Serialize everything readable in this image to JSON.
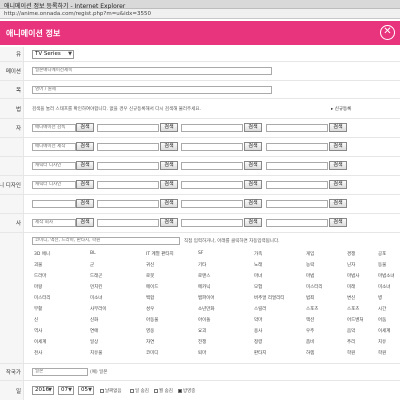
{
  "browser": {
    "title": "애니메이션 정보 등록하기 - Internet Explorer",
    "url": "http://anime.onnada.com/regist.php?m=u&idx=3550"
  },
  "header": {
    "title": "애니메이션 정보",
    "close_glyph": "✕"
  },
  "labels": {
    "type": "유",
    "title_row": "메이션",
    "orig_row": "목",
    "notice_row": "법",
    "r1": "자",
    "r2": "",
    "r3": "",
    "r4": "애니 디자인",
    "r5": "",
    "r6": "사",
    "country": "작국가",
    "date": "일"
  },
  "type_select": "TV Series",
  "title_value": "일본애니메이션제목",
  "orig_value": "영어 / 원제",
  "notice_text": "검색을 눌러 스태프를 확인하여야합니다. 없을 경우 신규등록해서 다시 검색해 불러주세요.",
  "notice_link": "▸ 신규등록",
  "search_label": "검색",
  "staff_rows": [
    [
      "애니메이션 감독",
      "",
      "",
      ""
    ],
    [
      "애니메이션 제작",
      "",
      "",
      ""
    ],
    [
      "캐릭터 디자인",
      "",
      "",
      ""
    ],
    [
      "캐릭터 디자인",
      "",
      "",
      ""
    ],
    [
      "",
      "",
      "",
      ""
    ],
    [
      "제작 회사",
      "",
      "",
      ""
    ]
  ],
  "genre_hint": "직접 입력하거나, 아래를 클릭하면 자동입력됩니다.",
  "genre_input": "코미디, 액션, 드라마, 판타지, 학원",
  "genres": [
    [
      "3D 애니",
      "BL",
      "IT 계열 판타지",
      "SF",
      "가족",
      "게임",
      "경쟁",
      "공포"
    ],
    [
      "괴물",
      "군",
      "귀신",
      "기타",
      "노래",
      "농락",
      "닌자",
      "동물"
    ],
    [
      "드라마",
      "드래곤",
      "로봇",
      "로맨스",
      "마녀",
      "마법",
      "마법사",
      "마법소녀"
    ],
    [
      "마왕",
      "먼치킨",
      "메이드",
      "메카닉",
      "모험",
      "미스터리",
      "미래",
      "미소녀"
    ],
    [
      "미스터리",
      "미소녀",
      "백합",
      "뱀파이어",
      "버추얼 리얼리티",
      "범죄",
      "변신",
      "병"
    ],
    [
      "부활",
      "사무라이",
      "성우",
      "소년만화",
      "스릴러",
      "스포츠",
      "스포츠",
      "시간"
    ],
    [
      "신",
      "신화",
      "아동물",
      "아이돌",
      "악마",
      "액션",
      "어드벤처",
      "어둠"
    ],
    [
      "역사",
      "연애",
      "영웅",
      "요괴",
      "용사",
      "우주",
      "음악",
      "이세계"
    ],
    [
      "이세계",
      "일상",
      "자연",
      "전쟁",
      "정령",
      "좀비",
      "추리",
      "치유"
    ],
    [
      "천사",
      "치유물",
      "코미디",
      "퇴마",
      "판타지",
      "하렘",
      "학원",
      "학원"
    ]
  ],
  "country_value": "일본",
  "country_suffix": "(예) 일본",
  "date": {
    "year": "2016",
    "month": "07",
    "day": "05"
  },
  "date_checks": [
    "날짜없음",
    "일 숨김",
    "월 숨김",
    "방영중"
  ]
}
